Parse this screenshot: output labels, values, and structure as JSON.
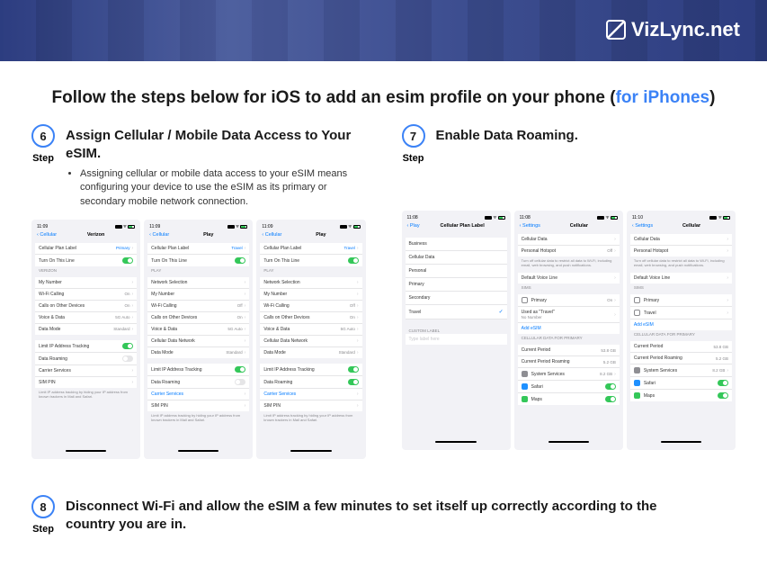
{
  "logo": "VizLync.net",
  "title_pre": "Follow the steps below for iOS to add an esim profile on your phone (",
  "title_link": "for iPhones",
  "title_post": ")",
  "step_label": "Step",
  "step6": {
    "num": "6",
    "title": "Assign Cellular / Mobile Data Access to Your eSIM.",
    "desc": "Assigning cellular or mobile data access to your eSIM means configuring your device to use the eSIM as its primary or secondary mobile network connection."
  },
  "step7": {
    "num": "7",
    "title": "Enable Data Roaming."
  },
  "step8": {
    "num": "8",
    "title": "Disconnect Wi-Fi and allow the eSIM a few minutes to set itself up correctly according to the country you are in."
  },
  "s6a": {
    "time": "11:09",
    "back": "Cellular",
    "title": "Verizon",
    "r1": "Cellular Plan Label",
    "r1v": "Primary",
    "r2": "Turn On This Line",
    "sec1": "VERIZON",
    "r3": "My Number",
    "r4": "Wi-Fi Calling",
    "r4v": "On",
    "r5": "Calls on Other Devices",
    "r5v": "On",
    "r6": "Voice & Data",
    "r6v": "5G Auto",
    "r7": "Data Mode",
    "r7v": "Standard",
    "r8": "Limit IP Address Tracking",
    "r9": "Data Roaming",
    "r10": "Carrier Services",
    "r11": "SIM PIN",
    "foot": "Limit IP address tracking by hiding your IP address from known trackers in Mail and Safari."
  },
  "s6b": {
    "time": "11:09",
    "back": "Cellular",
    "title": "Play",
    "r1": "Cellular Plan Label",
    "r1v": "Travel",
    "r2": "Turn On This Line",
    "sec1": "PLAY",
    "r3": "Network Selection",
    "r4": "My Number",
    "r5": "Wi-Fi Calling",
    "r5v": "Off",
    "r6": "Calls on Other Devices",
    "r6v": "On",
    "r7": "Voice & Data",
    "r7v": "5G Auto",
    "r8": "Cellular Data Network",
    "r9": "Data Mode",
    "r9v": "Standard",
    "r10": "Limit IP Address Tracking",
    "r11": "Data Roaming",
    "r12": "Carrier Services",
    "r13": "SIM PIN",
    "foot": "Limit IP address tracking by hiding your IP address from known trackers in Mail and Safari."
  },
  "s7a": {
    "time": "11:08",
    "back": "Play",
    "title": "Cellular Plan Label",
    "o1": "Business",
    "o2": "Cellular Data",
    "o3": "Personal",
    "o4": "Primary",
    "o5": "Secondary",
    "o6": "Travel",
    "sec": "CUSTOM LABEL",
    "ph": "Type label here"
  },
  "s7b": {
    "time": "11:08",
    "back": "Settings",
    "title": "Cellular",
    "r1": "Cellular Data",
    "r2": "Personal Hotspot",
    "r2v": "Off",
    "foot1": "Turn off cellular data to restrict all data to Wi-Fi, including email, web browsing, and push notifications.",
    "r3": "Default Voice Line",
    "sec1": "SIMS",
    "r4": "Primary",
    "r4v": "On",
    "r5l1": "Used as \"Travel\"",
    "r5l2": "No Number",
    "r6": "Add eSIM",
    "sec2": "CELLULAR DATA FOR PRIMARY",
    "r7": "Current Period",
    "r7v": "53.8 GB",
    "r8": "Current Period Roaming",
    "r8v": "5.2 GB",
    "r9": "System Services",
    "r9v": "8.2 GB",
    "r10": "Safari",
    "r11": "Maps"
  },
  "s7c": {
    "time": "11:10",
    "back": "Settings",
    "title": "Cellular",
    "r1": "Cellular Data",
    "r2": "Personal Hotspot",
    "foot1": "Turn off cellular data to restrict all data to Wi-Fi, including email, web browsing, and push notifications.",
    "r3": "Default Voice Line",
    "sec1": "SIMS",
    "r4": "Primary",
    "r5": "Travel",
    "r6": "Add eSIM",
    "sec2": "CELLULAR DATA FOR PRIMARY",
    "r7": "Current Period",
    "r7v": "53.8 GB",
    "r8": "Current Period Roaming",
    "r8v": "5.2 GB",
    "r9": "System Services",
    "r9v": "8.2 GB",
    "r10": "Safari",
    "r11": "Maps"
  }
}
